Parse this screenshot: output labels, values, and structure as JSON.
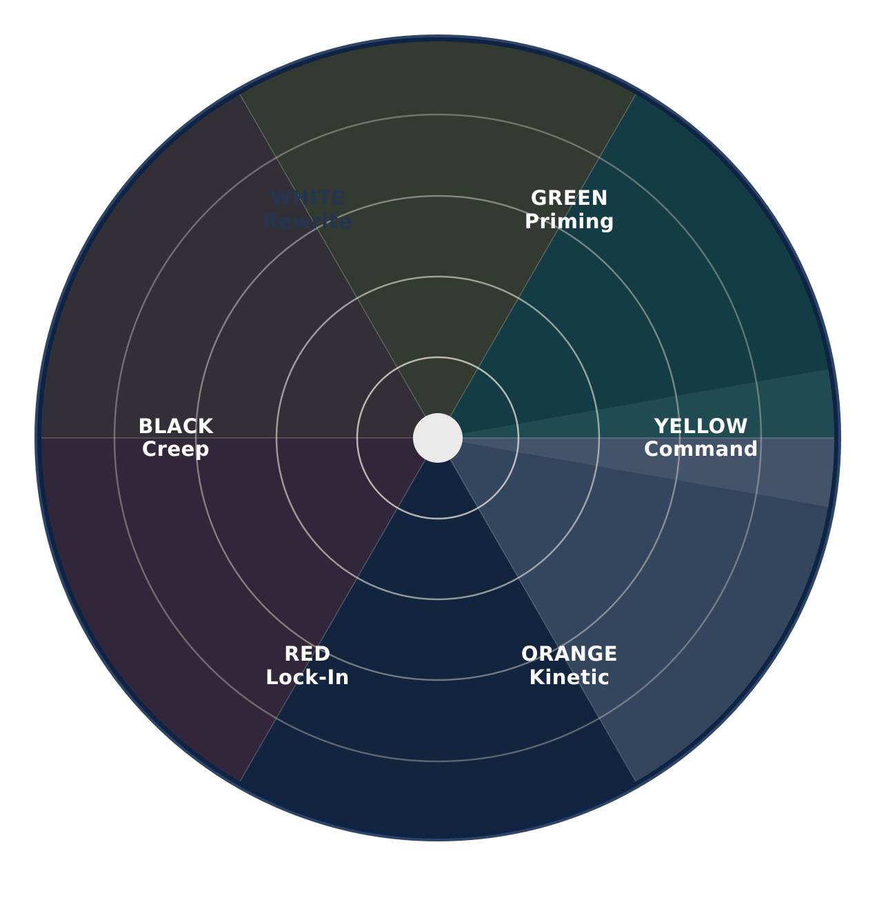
{
  "wheel": {
    "sectors": [
      {
        "key": "white",
        "line1": "WHITE",
        "line2": "Rewrite",
        "fill": "#333a32",
        "label_color": "#243550"
      },
      {
        "key": "green",
        "line1": "GREEN",
        "line2": "Priming",
        "fill": "#143c45",
        "label_color": "#ffffff"
      },
      {
        "key": "yellow",
        "line1": "YELLOW",
        "line2": "Command",
        "fill": "#214b53",
        "label_color": "#ffffff"
      },
      {
        "key": "orange",
        "line1": "ORANGE",
        "line2": "Kinetic",
        "fill": "#33465e",
        "label_color": "#ffffff"
      },
      {
        "key": "red",
        "line1": "RED",
        "line2": "Lock-In",
        "fill": "#12243e",
        "label_color": "#ffffff"
      },
      {
        "key": "black",
        "line1": "BLACK",
        "line2": "Creep",
        "fill": "#322f37",
        "label_color": "#ffffff"
      }
    ],
    "colors": {
      "rim": "#0f2445",
      "lower_left_fill": "#32273a",
      "yellow_wedge_fill": "#42536a",
      "ring_stroke": "#e6e6e6",
      "hub_fill": "#eaeaea"
    }
  }
}
